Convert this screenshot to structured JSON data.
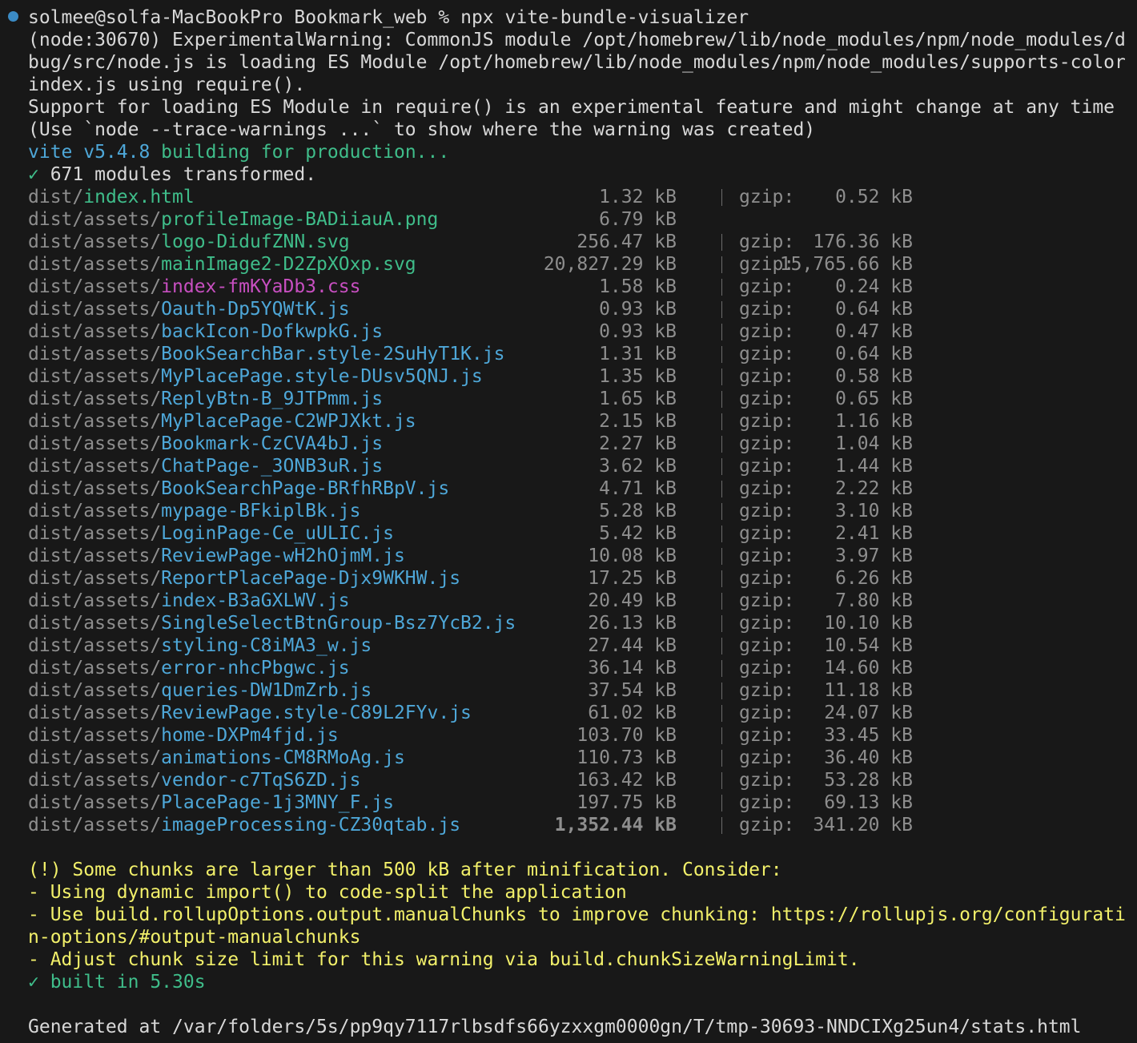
{
  "terminal": {
    "prompt_user": "solmee@solfa-MacBookPro",
    "prompt_dir": "Bookmark_web",
    "prompt_symbol": "%",
    "command": "npx vite-bundle-visualizer",
    "warning_lines": [
      "(node:30670) ExperimentalWarning: CommonJS module /opt/homebrew/lib/node_modules/npm/node_modules/d",
      "bug/src/node.js is loading ES Module /opt/homebrew/lib/node_modules/npm/node_modules/supports-color",
      "index.js using require().",
      "Support for loading ES Module in require() is an experimental feature and might change at any time",
      "(Use `node --trace-warnings ...` to show where the warning was created)"
    ],
    "vite_version": "vite v5.4.8",
    "build_message": " building for production...",
    "transformed": "✓ 671 modules transformed.",
    "gzip_label": "gzip:",
    "unit": "kB",
    "files": [
      {
        "prefix": "dist/",
        "name": "index.html",
        "size": "1.32",
        "gzip": "0.52",
        "color": "green",
        "has_gzip": true
      },
      {
        "prefix": "dist/assets/",
        "name": "profileImage-BADiiauA.png",
        "size": "6.79",
        "gzip": "",
        "color": "green",
        "has_gzip": false
      },
      {
        "prefix": "dist/assets/",
        "name": "logo-DidufZNN.svg",
        "size": "256.47",
        "gzip": "176.36",
        "color": "green",
        "has_gzip": true
      },
      {
        "prefix": "dist/assets/",
        "name": "mainImage2-D2ZpXOxp.svg",
        "size": "20,827.29",
        "gzip": "15,765.66",
        "color": "green",
        "has_gzip": true
      },
      {
        "prefix": "dist/assets/",
        "name": "index-fmKYaDb3.css",
        "size": "1.58",
        "gzip": "0.24",
        "color": "magenta",
        "has_gzip": true
      },
      {
        "prefix": "dist/assets/",
        "name": "Oauth-Dp5YQWtK.js",
        "size": "0.93",
        "gzip": "0.64",
        "color": "cyan",
        "has_gzip": true
      },
      {
        "prefix": "dist/assets/",
        "name": "backIcon-DofkwpkG.js",
        "size": "0.93",
        "gzip": "0.47",
        "color": "cyan",
        "has_gzip": true
      },
      {
        "prefix": "dist/assets/",
        "name": "BookSearchBar.style-2SuHyT1K.js",
        "size": "1.31",
        "gzip": "0.64",
        "color": "cyan",
        "has_gzip": true
      },
      {
        "prefix": "dist/assets/",
        "name": "MyPlacePage.style-DUsv5QNJ.js",
        "size": "1.35",
        "gzip": "0.58",
        "color": "cyan",
        "has_gzip": true
      },
      {
        "prefix": "dist/assets/",
        "name": "ReplyBtn-B_9JTPmm.js",
        "size": "1.65",
        "gzip": "0.65",
        "color": "cyan",
        "has_gzip": true
      },
      {
        "prefix": "dist/assets/",
        "name": "MyPlacePage-C2WPJXkt.js",
        "size": "2.15",
        "gzip": "1.16",
        "color": "cyan",
        "has_gzip": true
      },
      {
        "prefix": "dist/assets/",
        "name": "Bookmark-CzCVA4bJ.js",
        "size": "2.27",
        "gzip": "1.04",
        "color": "cyan",
        "has_gzip": true
      },
      {
        "prefix": "dist/assets/",
        "name": "ChatPage-_3ONB3uR.js",
        "size": "3.62",
        "gzip": "1.44",
        "color": "cyan",
        "has_gzip": true
      },
      {
        "prefix": "dist/assets/",
        "name": "BookSearchPage-BRfhRBpV.js",
        "size": "4.71",
        "gzip": "2.22",
        "color": "cyan",
        "has_gzip": true
      },
      {
        "prefix": "dist/assets/",
        "name": "mypage-BFkiplBk.js",
        "size": "5.28",
        "gzip": "3.10",
        "color": "cyan",
        "has_gzip": true
      },
      {
        "prefix": "dist/assets/",
        "name": "LoginPage-Ce_uULIC.js",
        "size": "5.42",
        "gzip": "2.41",
        "color": "cyan",
        "has_gzip": true
      },
      {
        "prefix": "dist/assets/",
        "name": "ReviewPage-wH2hOjmM.js",
        "size": "10.08",
        "gzip": "3.97",
        "color": "cyan",
        "has_gzip": true
      },
      {
        "prefix": "dist/assets/",
        "name": "ReportPlacePage-Djx9WKHW.js",
        "size": "17.25",
        "gzip": "6.26",
        "color": "cyan",
        "has_gzip": true
      },
      {
        "prefix": "dist/assets/",
        "name": "index-B3aGXLWV.js",
        "size": "20.49",
        "gzip": "7.80",
        "color": "cyan",
        "has_gzip": true
      },
      {
        "prefix": "dist/assets/",
        "name": "SingleSelectBtnGroup-Bsz7YcB2.js",
        "size": "26.13",
        "gzip": "10.10",
        "color": "cyan",
        "has_gzip": true
      },
      {
        "prefix": "dist/assets/",
        "name": "styling-C8iMA3_w.js",
        "size": "27.44",
        "gzip": "10.54",
        "color": "cyan",
        "has_gzip": true
      },
      {
        "prefix": "dist/assets/",
        "name": "error-nhcPbgwc.js",
        "size": "36.14",
        "gzip": "14.60",
        "color": "cyan",
        "has_gzip": true
      },
      {
        "prefix": "dist/assets/",
        "name": "queries-DW1DmZrb.js",
        "size": "37.54",
        "gzip": "11.18",
        "color": "cyan",
        "has_gzip": true
      },
      {
        "prefix": "dist/assets/",
        "name": "ReviewPage.style-C89L2FYv.js",
        "size": "61.02",
        "gzip": "24.07",
        "color": "cyan",
        "has_gzip": true
      },
      {
        "prefix": "dist/assets/",
        "name": "home-DXPm4fjd.js",
        "size": "103.70",
        "gzip": "33.45",
        "color": "cyan",
        "has_gzip": true
      },
      {
        "prefix": "dist/assets/",
        "name": "animations-CM8RMoAg.js",
        "size": "110.73",
        "gzip": "36.40",
        "color": "cyan",
        "has_gzip": true
      },
      {
        "prefix": "dist/assets/",
        "name": "vendor-c7TqS6ZD.js",
        "size": "163.42",
        "gzip": "53.28",
        "color": "cyan",
        "has_gzip": true
      },
      {
        "prefix": "dist/assets/",
        "name": "PlacePage-1j3MNY_F.js",
        "size": "197.75",
        "gzip": "69.13",
        "color": "cyan",
        "has_gzip": true
      },
      {
        "prefix": "dist/assets/",
        "name": "imageProcessing-CZ30qtab.js",
        "size": "1,352.44",
        "gzip": "341.20",
        "color": "cyan",
        "has_gzip": true,
        "highlight": true
      }
    ],
    "chunk_warning_lines": [
      "(!) Some chunks are larger than 500 kB after minification. Consider:",
      "- Using dynamic import() to code-split the application",
      "- Use build.rollupOptions.output.manualChunks to improve chunking: https://rollupjs.org/configurati",
      "n-options/#output-manualchunks",
      "- Adjust chunk size limit for this warning via build.chunkSizeWarningLimit."
    ],
    "built_message": "✓ built in 5.30s",
    "generated_line": "Generated at /var/folders/5s/pp9qy7117rlbsdfs66yzxxgm0000gn/T/tmp-30693-NNDCIXg25un4/stats.html",
    "colors": {
      "background": "#181818",
      "white": "#d8d8d8",
      "cyan": "#4ea7d8",
      "green": "#3fbd8a",
      "gray": "#8e8e8e",
      "magenta": "#c84fc1",
      "yellow": "#f2f06a",
      "status_dot": "#3b8bc5"
    }
  }
}
